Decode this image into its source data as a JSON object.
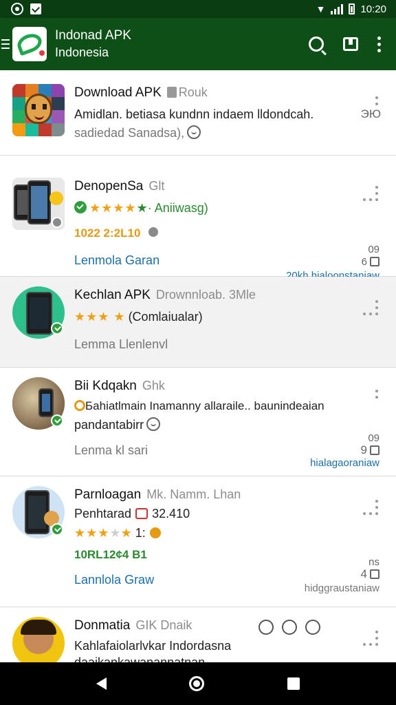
{
  "status_bar": {
    "time": "10:20"
  },
  "app_bar": {
    "title": "Indonad APK",
    "subtitle": "Indonesia"
  },
  "items": [
    {
      "title": "Download APK",
      "tag": "Rouk",
      "line1": "Amidlan. betiasa kundnn indaem lldondcah.",
      "line2": "sadiedad Sanadsa),",
      "right_top": "ЭЮ"
    },
    {
      "title": "DenopenSa",
      "tag": "Glt",
      "rating_text": "· Aniiwasg)",
      "version": "1022 2:2L10",
      "link": "Lenmola Garan",
      "right_top": "09",
      "right_mid": "6",
      "right_bottom": "20kh hialoonstaniaw"
    },
    {
      "title": "Kechlan APK",
      "tag": "Drownnloab. 3Mle",
      "rating_text": "(Comlaiualar)",
      "line": "Lemma Llenlenvl"
    },
    {
      "title": "Bii Kdqakn",
      "tag": "Ghk",
      "line1": "Бahiatlmain Inamanny allaraile.. baunindeaian",
      "line2": "pandantabirr",
      "link": "Lenma kl sari",
      "right_top": "09",
      "right_mid": "9",
      "right_bottom": "hialagaoraniaw"
    },
    {
      "title": "Parnloagan",
      "tag": "Mk. Namm. Lhan",
      "line1_label": "Penhtarad",
      "line1_value": "32.410",
      "rating_text": "1:",
      "version": "10RL12¢4 B1",
      "link": "Lannlola Graw",
      "right_top": "ns",
      "right_mid": "4",
      "right_bottom": "hidggraustaniaw"
    },
    {
      "title": "Donmatia",
      "tag": "GIK Dnaik",
      "line1": "Kahlafaiolarlvkar Indordasna",
      "line2": "daaikankawanannatnan"
    }
  ]
}
